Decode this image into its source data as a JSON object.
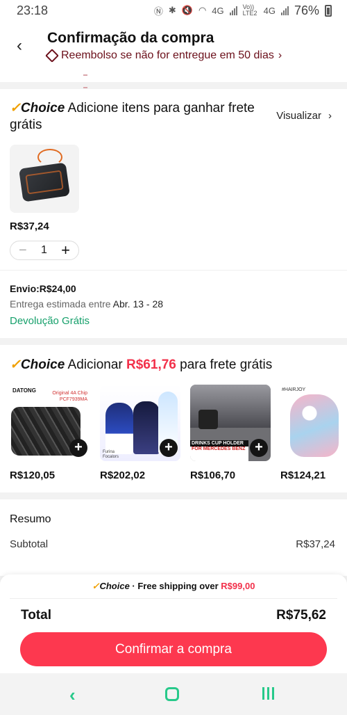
{
  "status_bar": {
    "time": "23:18",
    "net1": "4G",
    "volte": "Vo)) LTE2",
    "net2": "4G",
    "battery": "76%"
  },
  "header": {
    "title": "Confirmação da compra",
    "subtitle": "Reembolso se não for entregue em 50 dias"
  },
  "choice_section": {
    "badge": "Choice",
    "heading": "Adicione itens para ganhar frete grátis",
    "view_label": "Visualizar",
    "product_price": "R$37,24",
    "quantity": "1",
    "shipping": "Envio:R$24,00",
    "eta_prefix": "Entrega estimada entre",
    "eta_dates": "Abr. 13 - 28",
    "free_return": "Devolução Grátis"
  },
  "add_section": {
    "badge": "Choice",
    "heading_before": "Adicionar",
    "amount": "R$61,76",
    "heading_after": "para frete grátis",
    "items": [
      {
        "price": "R$120,05",
        "logo": "DATONG",
        "chip": "Original 4A Chip PCF7939MA"
      },
      {
        "price": "R$202,02",
        "caption": "Furina Focalors"
      },
      {
        "price": "R$106,70",
        "label1": "DRINKS CUP HOLDER",
        "label2": "FOR MERCEDES BENZ"
      },
      {
        "price": "R$124,21",
        "tag": "#HAIRJOY"
      }
    ]
  },
  "summary": {
    "title": "Resumo",
    "subtotal_label": "Subtotal",
    "subtotal_value": "R$37,24"
  },
  "footer": {
    "promo_badge": "Choice",
    "promo_text": "· Free shipping over",
    "promo_amount": "R$99,00",
    "total_label": "Total",
    "total_value": "R$75,62",
    "confirm_label": "Confirmar a compra"
  },
  "colors": {
    "accent": "#fd384f",
    "choice_gold": "#f0a000",
    "green": "#16a06b"
  }
}
